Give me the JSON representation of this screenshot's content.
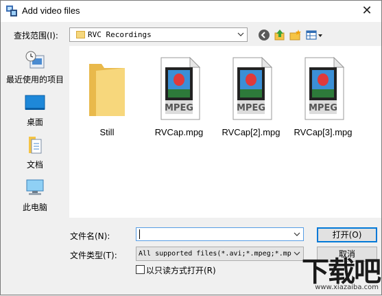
{
  "window": {
    "title": "Add video files"
  },
  "lookin": {
    "label": "查找范围(I):",
    "value": "RVC Recordings"
  },
  "places": [
    {
      "label": "最近使用的项目",
      "icon": "recent-items-icon"
    },
    {
      "label": "桌面",
      "icon": "desktop-icon"
    },
    {
      "label": "文档",
      "icon": "documents-icon"
    },
    {
      "label": "此电脑",
      "icon": "this-pc-icon"
    }
  ],
  "files": [
    {
      "name": "Still",
      "type": "folder"
    },
    {
      "name": "RVCap.mpg",
      "type": "mpeg"
    },
    {
      "name": "RVCap[2].mpg",
      "type": "mpeg"
    },
    {
      "name": "RVCap[3].mpg",
      "type": "mpeg"
    }
  ],
  "mpeg_badge": "MPEG",
  "filename": {
    "label": "文件名(N):",
    "value": ""
  },
  "filetype": {
    "label": "文件类型(T):",
    "value": "All supported files(*.avi;*.mpeg;*.mp"
  },
  "buttons": {
    "open": "打开(O)",
    "cancel": "取消"
  },
  "readonly_label": "以只读方式打开(R)",
  "watermark": {
    "main": "下载吧",
    "sub": "www.xiazaiba.com"
  }
}
